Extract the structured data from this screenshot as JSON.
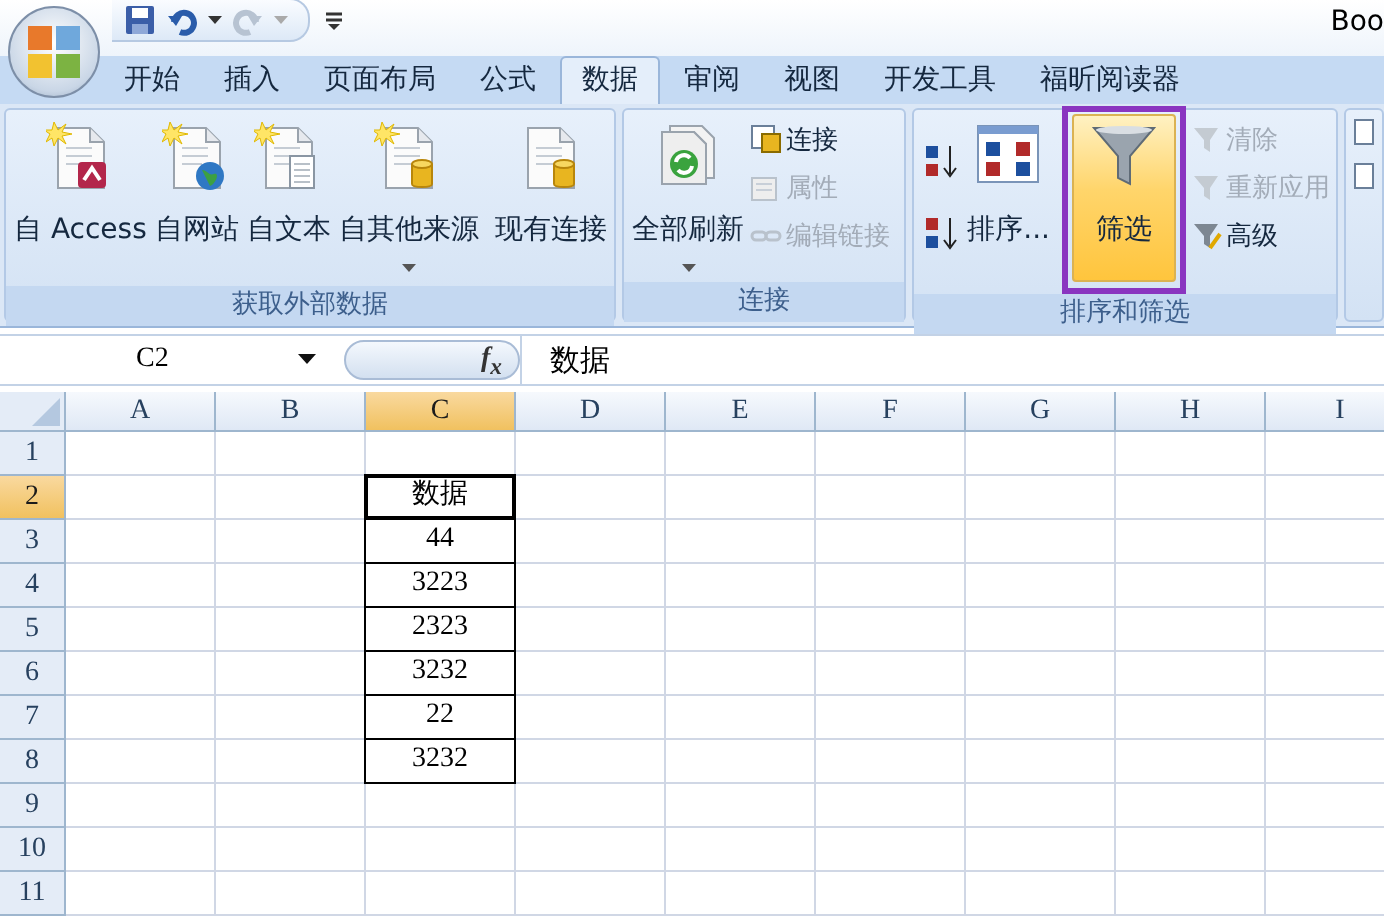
{
  "title": "Boo",
  "tabs": [
    {
      "label": "开始",
      "selected": false
    },
    {
      "label": "插入",
      "selected": false
    },
    {
      "label": "页面布局",
      "selected": false
    },
    {
      "label": "公式",
      "selected": false
    },
    {
      "label": "数据",
      "selected": true
    },
    {
      "label": "审阅",
      "selected": false
    },
    {
      "label": "视图",
      "selected": false
    },
    {
      "label": "开发工具",
      "selected": false
    },
    {
      "label": "福昕阅读器",
      "selected": false
    }
  ],
  "ribbon_groups": [
    {
      "label": "获取外部数据",
      "buttons": [
        {
          "label": "自 Access",
          "dropdown": false,
          "selected": false
        },
        {
          "label": "自网站",
          "dropdown": false,
          "selected": false
        },
        {
          "label": "自文本",
          "dropdown": false,
          "selected": false
        },
        {
          "label": "自其他来源",
          "dropdown": true,
          "selected": false
        },
        {
          "label": "现有连接",
          "dropdown": false,
          "selected": false
        }
      ]
    },
    {
      "label": "连接",
      "buttons": [
        {
          "label": "全部刷新",
          "dropdown": true,
          "selected": false
        }
      ],
      "small_buttons": [
        {
          "label": "连接",
          "disabled": false
        },
        {
          "label": "属性",
          "disabled": true
        },
        {
          "label": "编辑链接",
          "disabled": true
        }
      ]
    },
    {
      "label": "排序和筛选",
      "buttons": [
        {
          "label": "排序...",
          "dropdown": false,
          "selected": false
        },
        {
          "label": "筛选",
          "dropdown": false,
          "selected": true
        }
      ],
      "small_buttons": [
        {
          "label": "清除",
          "disabled": true
        },
        {
          "label": "重新应用",
          "disabled": true
        },
        {
          "label": "高级",
          "disabled": false
        }
      ]
    }
  ],
  "formula_bar": {
    "name_box": "C2",
    "function_button": "f$_{x}$",
    "formula": "数据"
  },
  "columns": [
    {
      "label": "A",
      "selected": false
    },
    {
      "label": "B",
      "selected": false
    },
    {
      "label": "C",
      "selected": true
    },
    {
      "label": "D",
      "selected": false
    },
    {
      "label": "E",
      "selected": false
    },
    {
      "label": "F",
      "selected": false
    },
    {
      "label": "G",
      "selected": false
    },
    {
      "label": "H",
      "selected": false
    },
    {
      "label": "I",
      "selected": false
    }
  ],
  "rows": [
    {
      "label": "1",
      "selected": false
    },
    {
      "label": "2",
      "selected": true,
      "c": "数据"
    },
    {
      "label": "3",
      "selected": false,
      "c": "44"
    },
    {
      "label": "4",
      "selected": false,
      "c": "3223"
    },
    {
      "label": "5",
      "selected": false,
      "c": "2323"
    },
    {
      "label": "6",
      "selected": false,
      "c": "3232"
    },
    {
      "label": "7",
      "selected": false,
      "c": "22"
    },
    {
      "label": "8",
      "selected": false,
      "c": "3232"
    },
    {
      "label": "9",
      "selected": false
    },
    {
      "label": "10",
      "selected": false
    },
    {
      "label": "11",
      "selected": false
    }
  ]
}
